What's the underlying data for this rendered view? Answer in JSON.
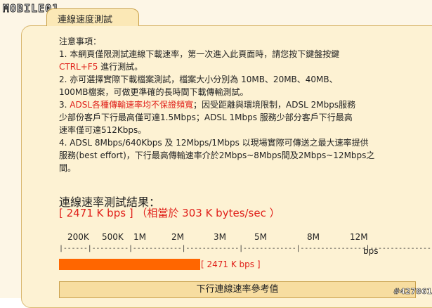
{
  "logo": {
    "text": "MOBILE01",
    "badge": "01"
  },
  "header": {
    "title": "連線速度測試"
  },
  "notes": {
    "heading": "注意事項：",
    "item1_a": "1. 本網頁僅限測試連線下載速率，第一次進入此頁面時，請您按下鍵盤按鍵",
    "item1_b_red": "CTRL+F5",
    "item1_b_rest": " 進行測試。",
    "item2_a": "2. 亦可選擇實際下載檔案測試，檔案大小分別為 10MB、20MB、40MB、",
    "item2_b": "100MB檔案，可做更準確的長時間下載傳輸測試。",
    "item3_prefix": "3. ",
    "item3_red": "ADSL各種傳輸速率均不保證頻寬",
    "item3_rest_a": "；因受距離與環境限制，ADSL 2Mbps服務",
    "item3_rest_b": "少部份客戶下行最高僅可達1.5Mbps；ADSL 1Mbps 服務少部分客戶下行最高",
    "item3_rest_c": "速率僅可達512Kbps。",
    "item4_a": "4. ADSL 8Mbps/640Kbps 及 12Mbps/1Mbps 以現場實際可傳送之最大速率提供",
    "item4_b": "服務(best effort)，下行最高傳輸速率介於2Mbps~8Mbps間及2Mbps~12Mbps之",
    "item4_c": "間。"
  },
  "result": {
    "title": "連線速率測試結果：",
    "value": "[ 2471 K bps ] （相當於 303 K bytes/sec ）"
  },
  "scale": {
    "labels": [
      "200K",
      "500K",
      "1M",
      "2M",
      "3M",
      "5M",
      "8M",
      "12M"
    ],
    "line": "|------|---------|------------|-------------|-------------|----------------|----------------|",
    "unit": "bps"
  },
  "bar": {
    "label": "[ 2471 K bps ]",
    "fill_fraction": 0.2,
    "color": "#ff6600"
  },
  "reference_button": {
    "label": "下行連線速率參考值"
  },
  "watermark": "#427861",
  "colors": {
    "accent_red": "#e0201a",
    "panel_bg": "#fdf2d3",
    "bar": "#ff6600"
  }
}
